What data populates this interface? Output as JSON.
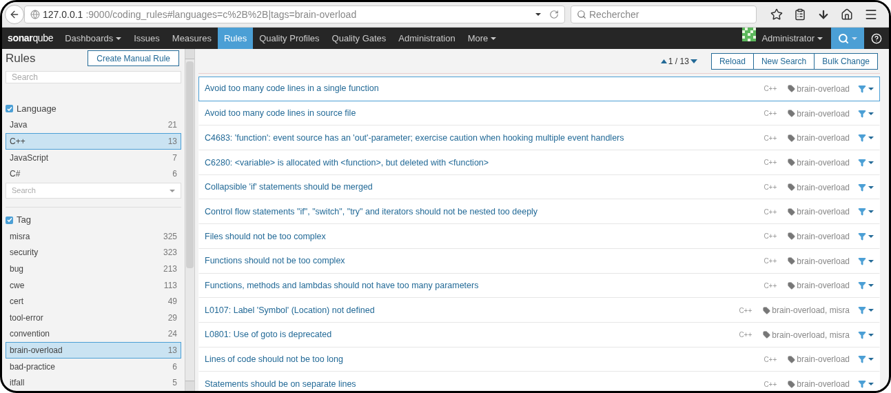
{
  "browser": {
    "url_host": "127.0.0.1",
    "url_path": ":9000/coding_rules#languages=c%2B%2B|tags=brain-overload",
    "search": {
      "placeholder": "Rechercher"
    }
  },
  "navbar": {
    "logo": "**sonar**qube",
    "items": [
      {
        "label": "Dashboards",
        "dropdown": true,
        "selected": false
      },
      {
        "label": "Issues",
        "dropdown": false,
        "selected": false
      },
      {
        "label": "Measures",
        "dropdown": false,
        "selected": false
      },
      {
        "label": "Rules",
        "dropdown": false,
        "selected": true
      },
      {
        "label": "Quality Profiles",
        "dropdown": false,
        "selected": false
      },
      {
        "label": "Quality Gates",
        "dropdown": false,
        "selected": false
      },
      {
        "label": "Administration",
        "dropdown": false,
        "selected": false
      },
      {
        "label": "More",
        "dropdown": true,
        "selected": false
      }
    ],
    "user": "Administrator"
  },
  "sidebar": {
    "title": "Rules",
    "create_button": "Create Manual Rule",
    "search": {
      "placeholder": "Search"
    },
    "facets": [
      {
        "title": "Language",
        "checked": true,
        "items": [
          {
            "label": "Java",
            "count": "21",
            "selected": false
          },
          {
            "label": "C++",
            "count": "13",
            "selected": true
          },
          {
            "label": "JavaScript",
            "count": "7",
            "selected": false
          },
          {
            "label": "C#",
            "count": "6",
            "selected": false
          }
        ],
        "search": {
          "placeholder": "Search"
        }
      },
      {
        "title": "Tag",
        "checked": true,
        "items": [
          {
            "label": "misra",
            "count": "325",
            "selected": false
          },
          {
            "label": "security",
            "count": "323",
            "selected": false
          },
          {
            "label": "bug",
            "count": "213",
            "selected": false
          },
          {
            "label": "cwe",
            "count": "113",
            "selected": false
          },
          {
            "label": "cert",
            "count": "49",
            "selected": false
          },
          {
            "label": "tool-error",
            "count": "29",
            "selected": false
          },
          {
            "label": "convention",
            "count": "24",
            "selected": false
          },
          {
            "label": "brain-overload",
            "count": "13",
            "selected": true
          },
          {
            "label": "bad-practice",
            "count": "6",
            "selected": false
          },
          {
            "label": "itfall",
            "count": "5",
            "selected": false
          }
        ]
      }
    ]
  },
  "toolbar": {
    "pager": "1 / 13",
    "buttons": [
      "Reload",
      "New Search",
      "Bulk Change"
    ]
  },
  "rules": [
    {
      "title": "Avoid too many code lines in a single function",
      "language": "C++",
      "tags": "brain-overload",
      "selected": true
    },
    {
      "title": "Avoid too many code lines in source file",
      "language": "C++",
      "tags": "brain-overload",
      "selected": false
    },
    {
      "title": "C4683: 'function': event source has an 'out'-parameter; exercise caution when hooking multiple event handlers",
      "language": "C++",
      "tags": "brain-overload",
      "selected": false
    },
    {
      "title": "C6280: <variable> is allocated with <function>, but deleted with <function>",
      "language": "C++",
      "tags": "brain-overload",
      "selected": false
    },
    {
      "title": "Collapsible 'if' statements should be merged",
      "language": "C++",
      "tags": "brain-overload",
      "selected": false
    },
    {
      "title": "Control flow statements \"if\", \"switch\", \"try\" and iterators should not be nested too deeply",
      "language": "C++",
      "tags": "brain-overload",
      "selected": false
    },
    {
      "title": "Files should not be too complex",
      "language": "C++",
      "tags": "brain-overload",
      "selected": false
    },
    {
      "title": "Functions should not be too complex",
      "language": "C++",
      "tags": "brain-overload",
      "selected": false
    },
    {
      "title": "Functions, methods and lambdas should not have too many parameters",
      "language": "C++",
      "tags": "brain-overload",
      "selected": false
    },
    {
      "title": "L0107: Label 'Symbol' (Location) not defined",
      "language": "C++",
      "tags": "brain-overload, misra",
      "selected": false
    },
    {
      "title": "L0801: Use of goto is deprecated",
      "language": "C++",
      "tags": "brain-overload, misra",
      "selected": false
    },
    {
      "title": "Lines of code should not be too long",
      "language": "C++",
      "tags": "brain-overload",
      "selected": false
    },
    {
      "title": "Statements should be on separate lines",
      "language": "C++",
      "tags": "brain-overload",
      "selected": false
    }
  ]
}
